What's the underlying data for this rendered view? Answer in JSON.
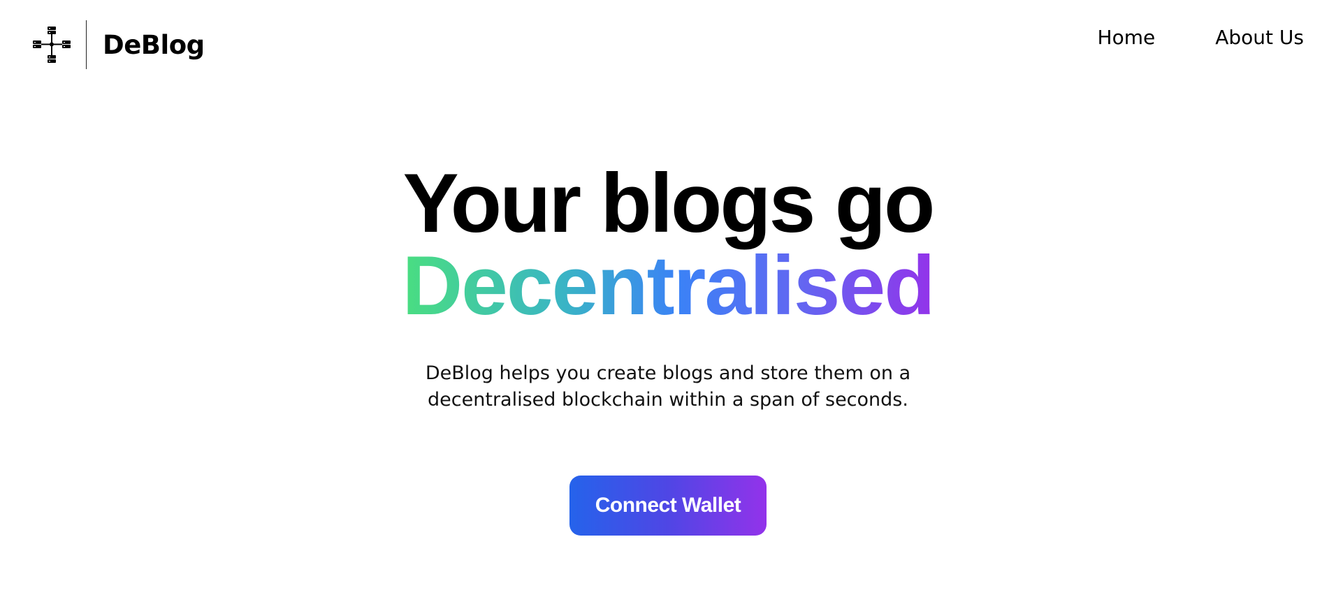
{
  "header": {
    "logo_icon": "network-nodes-icon",
    "brand_name": "DeBlog",
    "nav": [
      {
        "label": "Home"
      },
      {
        "label": "About Us"
      }
    ]
  },
  "hero": {
    "line1": "Your blogs go",
    "line2": "Decentralised",
    "subtitle": "DeBlog helps you create blogs and store them on a decentralised blockchain within a span of seconds.",
    "cta_label": "Connect Wallet"
  },
  "colors": {
    "gradient_start": "#4ade80",
    "gradient_mid": "#3b82f6",
    "gradient_end": "#9333ea",
    "button_start": "#2563eb",
    "button_end": "#9333ea"
  }
}
